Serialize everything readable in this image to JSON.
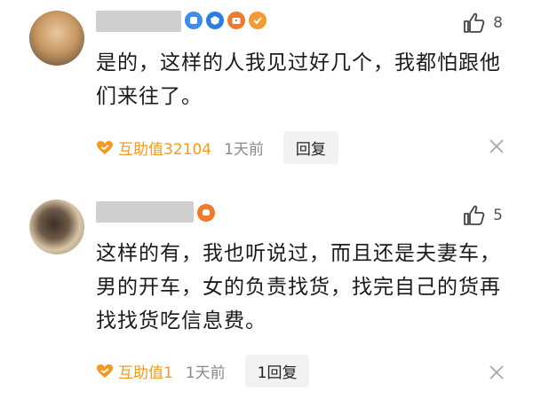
{
  "comments": [
    {
      "likes": "8",
      "text": "是的，这样的人我见过好几个，我都怕跟他们来往了。",
      "mutual_label": "互助值32104",
      "time": "1天前",
      "reply_label": "回复"
    },
    {
      "likes": "5",
      "text": "这样的有，我也听说过，而且还是夫妻车，男的开车，女的负责找货，找完自己的货再找找货吃信息费。",
      "mutual_label": "互助值1",
      "time": "1天前",
      "reply_label": "1回复"
    }
  ],
  "icons": {
    "like": "thumbs-up-icon",
    "mutual": "heart-handshake-icon",
    "close": "close-icon"
  },
  "colors": {
    "accent_orange": "#f39a1f",
    "badge_blue": "#3f8de8",
    "badge_orange": "#f07a2c"
  }
}
